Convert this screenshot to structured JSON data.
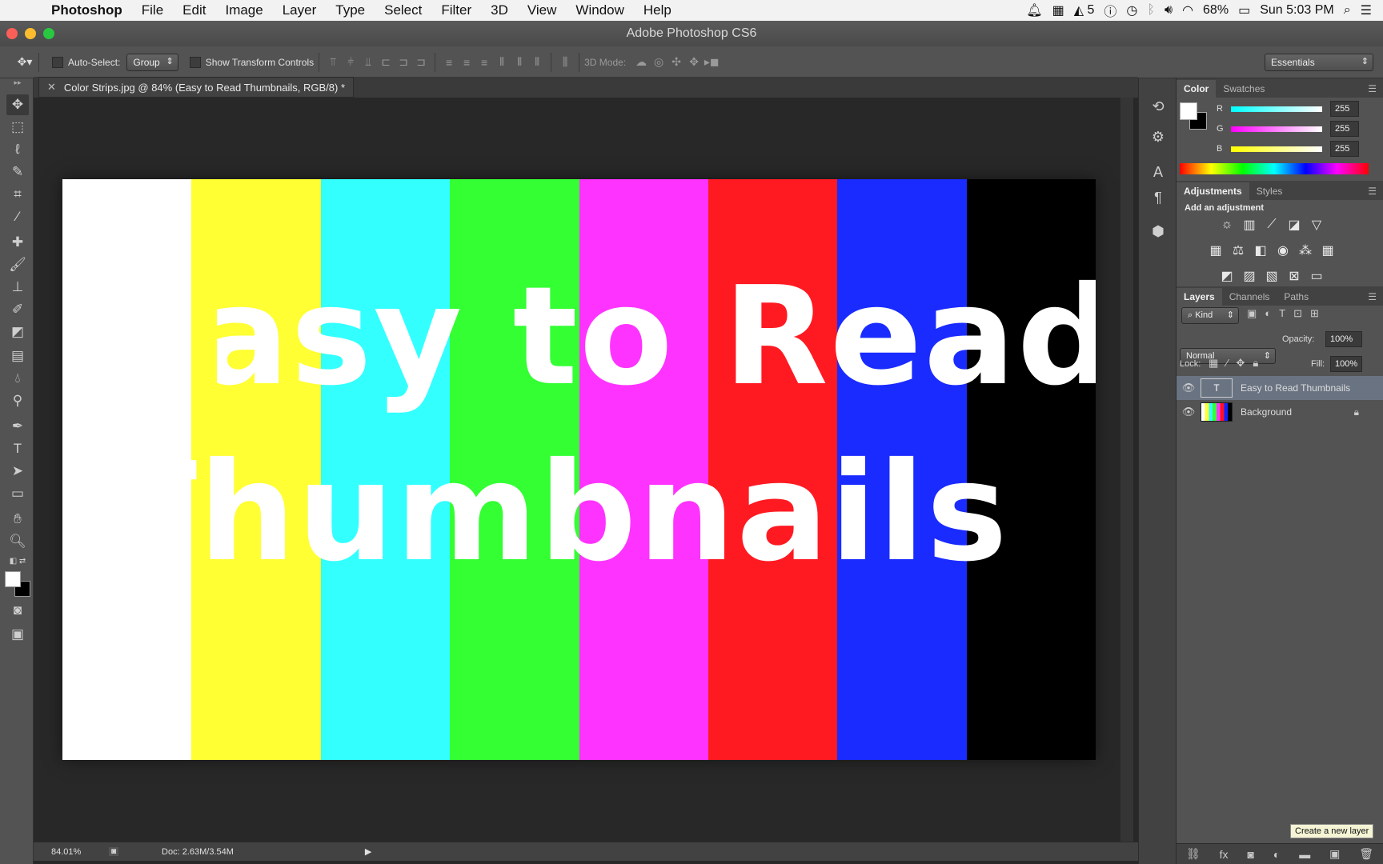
{
  "menubar": {
    "app_name": "Photoshop",
    "items": [
      "File",
      "Edit",
      "Image",
      "Layer",
      "Type",
      "Select",
      "Filter",
      "3D",
      "View",
      "Window",
      "Help"
    ],
    "notification_count": "5",
    "battery": "68%",
    "clock": "Sun 5:03 PM"
  },
  "window": {
    "title": "Adobe Photoshop CS6"
  },
  "options": {
    "auto_select_label": "Auto-Select:",
    "auto_select_value": "Group",
    "show_transform_label": "Show Transform Controls",
    "mode_3d_label": "3D Mode:",
    "workspace": "Essentials"
  },
  "document": {
    "tab_title": "Color Strips.jpg @ 84% (Easy to Read Thumbnails, RGB/8) *",
    "line1": "Easy to Read",
    "line2": "Thumbnails",
    "strip_colors": [
      "#ffffff",
      "#ffff33",
      "#33ffff",
      "#33ff33",
      "#ff33ff",
      "#ff1a22",
      "#1a2bff",
      "#000000"
    ]
  },
  "statusbar": {
    "zoom": "84.01%",
    "doc_size": "Doc: 2.63M/3.54M"
  },
  "color_panel": {
    "tabs": [
      "Color",
      "Swatches"
    ],
    "channels": [
      {
        "label": "R",
        "value": "255",
        "color": "#33e0e0"
      },
      {
        "label": "G",
        "value": "255",
        "color": "#e033e0"
      },
      {
        "label": "B",
        "value": "255",
        "color": "#e0e033"
      }
    ]
  },
  "adjustments_panel": {
    "tabs": [
      "Adjustments",
      "Styles"
    ],
    "heading": "Add an adjustment"
  },
  "layers_panel": {
    "tabs": [
      "Layers",
      "Channels",
      "Paths"
    ],
    "filter_kind": "Kind",
    "blend_mode": "Normal",
    "opacity_label": "Opacity:",
    "opacity_value": "100%",
    "lock_label": "Lock:",
    "fill_label": "Fill:",
    "fill_value": "100%",
    "layers": [
      {
        "name": "Easy to Read Thumbnails",
        "type": "text",
        "selected": true
      },
      {
        "name": "Background",
        "type": "image",
        "locked": true
      }
    ],
    "tooltip": "Create a new layer"
  }
}
